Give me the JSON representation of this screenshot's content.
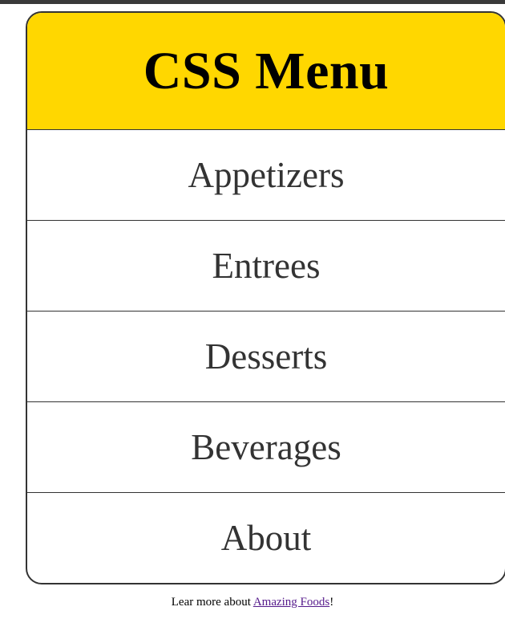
{
  "menu": {
    "title": "CSS Menu",
    "items": [
      {
        "label": "Appetizers"
      },
      {
        "label": "Entrees"
      },
      {
        "label": "Desserts"
      },
      {
        "label": "Beverages"
      },
      {
        "label": "About"
      }
    ]
  },
  "footer": {
    "prefix": "Lear more about ",
    "link_text": "Amazing Foods",
    "suffix": "!"
  },
  "colors": {
    "header_bg": "#ffd700",
    "text": "#333333",
    "link": "#551a8b"
  }
}
